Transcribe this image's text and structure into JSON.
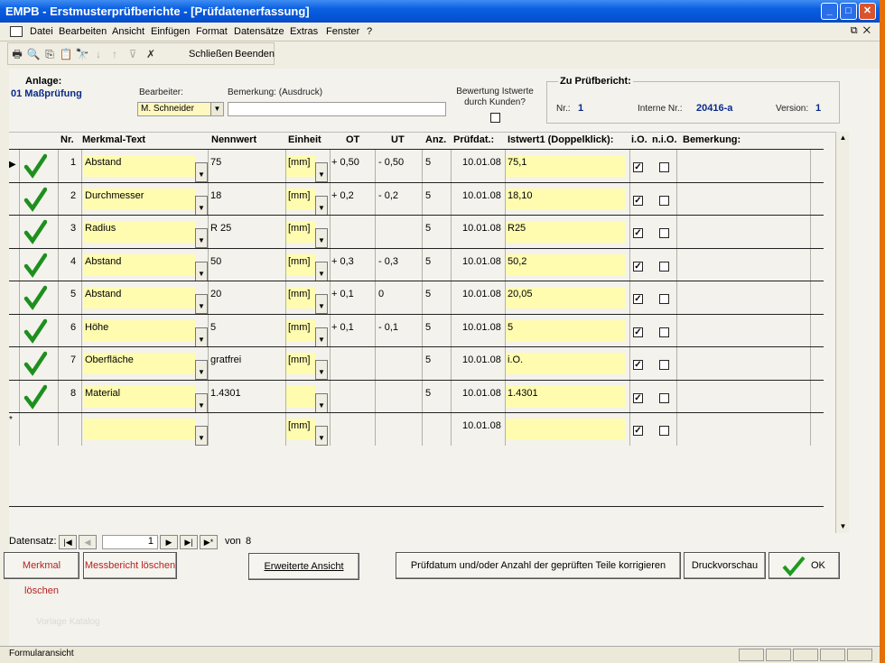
{
  "window": {
    "title": "EMPB - Erstmusterprüfberichte - [Prüfdatenerfassung]"
  },
  "menu": [
    "Datei",
    "Bearbeiten",
    "Ansicht",
    "Einfügen",
    "Format",
    "Datensätze",
    "Extras",
    "Fenster",
    "?"
  ],
  "toolbar": {
    "close_label": "Schließen",
    "exit_label": "Beenden"
  },
  "header": {
    "anlage_label": "Anlage:",
    "anlage_value": "01 Maßprüfung",
    "bearbeiter_label": "Bearbeiter:",
    "bearbeiter_value": "M. Schneider",
    "bemerkung_label": "Bemerkung: (Ausdruck)",
    "bemerkung_value": "",
    "bewertung_label": "Bewertung Istwerte durch Kunden?",
    "zu_pruefbericht_label": "Zu Prüfbericht:",
    "nr_label": "Nr.:",
    "nr_value": "1",
    "interne_nr_label": "Interne Nr.:",
    "interne_nr_value": "20416-a",
    "version_label": "Version:",
    "version_value": "1"
  },
  "grid": {
    "columns": [
      "Nr.",
      "Merkmal-Text",
      "Nennwert",
      "Einheit",
      "OT",
      "UT",
      "Anz.",
      "Prüfdat.:",
      "Istwert1 (Doppelklick):",
      "i.O.",
      "n.i.O.",
      "Bemerkung:"
    ],
    "rows": [
      {
        "nr": "1",
        "merkmal": "Abstand",
        "nennwert": "75",
        "einheit": "[mm]",
        "ot": "+ 0,50",
        "ut": "- 0,50",
        "anz": "5",
        "pruefdat": "10.01.08",
        "istwert": "75,1",
        "io": true,
        "nio": false,
        "ok": true
      },
      {
        "nr": "2",
        "merkmal": "Durchmesser",
        "nennwert": "18",
        "einheit": "[mm]",
        "ot": "+ 0,2",
        "ut": "- 0,2",
        "anz": "5",
        "pruefdat": "10.01.08",
        "istwert": "18,10",
        "io": true,
        "nio": false,
        "ok": true
      },
      {
        "nr": "3",
        "merkmal": "Radius",
        "nennwert": "R 25",
        "einheit": "[mm]",
        "ot": "",
        "ut": "",
        "anz": "5",
        "pruefdat": "10.01.08",
        "istwert": "R25",
        "io": true,
        "nio": false,
        "ok": true
      },
      {
        "nr": "4",
        "merkmal": "Abstand",
        "nennwert": "50",
        "einheit": "[mm]",
        "ot": "+ 0,3",
        "ut": "- 0,3",
        "anz": "5",
        "pruefdat": "10.01.08",
        "istwert": "50,2",
        "io": true,
        "nio": false,
        "ok": true
      },
      {
        "nr": "5",
        "merkmal": "Abstand",
        "nennwert": "20",
        "einheit": "[mm]",
        "ot": "+ 0,1",
        "ut": "0",
        "anz": "5",
        "pruefdat": "10.01.08",
        "istwert": "20,05",
        "io": true,
        "nio": false,
        "ok": true
      },
      {
        "nr": "6",
        "merkmal": "Höhe",
        "nennwert": "5",
        "einheit": "[mm]",
        "ot": "+ 0,1",
        "ut": "- 0,1",
        "anz": "5",
        "pruefdat": "10.01.08",
        "istwert": "5",
        "io": true,
        "nio": false,
        "ok": true
      },
      {
        "nr": "7",
        "merkmal": "Oberfläche",
        "nennwert": "gratfrei",
        "einheit": "[mm]",
        "ot": "",
        "ut": "",
        "anz": "5",
        "pruefdat": "10.01.08",
        "istwert": "i.O.",
        "io": true,
        "nio": false,
        "ok": true
      },
      {
        "nr": "8",
        "merkmal": "Material",
        "nennwert": "1.4301",
        "einheit": "",
        "ot": "",
        "ut": "",
        "anz": "5",
        "pruefdat": "10.01.08",
        "istwert": "1.4301",
        "io": true,
        "nio": false,
        "ok": true
      },
      {
        "nr": "",
        "merkmal": "",
        "nennwert": "",
        "einheit": "[mm]",
        "ot": "",
        "ut": "",
        "anz": "",
        "pruefdat": "10.01.08",
        "istwert": "",
        "io": true,
        "nio": false,
        "ok": false,
        "new": true
      }
    ]
  },
  "navigation": {
    "label": "Datensatz:",
    "current": "1",
    "of_label": "von",
    "total": "8"
  },
  "buttons": {
    "delete_feature": "Merkmal löschen",
    "delete_report": "Messbericht löschen",
    "extended_view": "Erweiterte Ansicht",
    "correct": "Prüfdatum und/oder Anzahl der geprüften Teile korrigieren",
    "print_preview": "Druckvorschau",
    "ok": "OK"
  },
  "status": {
    "text": "Formularansicht",
    "watermark": "Vorlage Katalog"
  }
}
